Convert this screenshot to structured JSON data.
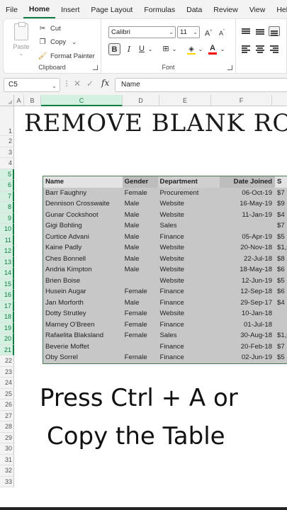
{
  "menu": [
    "File",
    "Home",
    "Insert",
    "Page Layout",
    "Formulas",
    "Data",
    "Review",
    "View",
    "Help"
  ],
  "menu_active": "Home",
  "clipboard": {
    "paste_label": "Paste",
    "cut_label": "Cut",
    "copy_label": "Copy",
    "format_painter_label": "Format Painter",
    "group_label": "Clipboard"
  },
  "font_group": {
    "font_name": "Calibri",
    "font_size": "11",
    "group_label": "Font",
    "bold": "B",
    "italic": "I",
    "underline": "U",
    "grow": "A",
    "shrink": "A"
  },
  "formula_bar": {
    "name_box": "C5",
    "formula": "Name"
  },
  "columns": [
    "A",
    "B",
    "C",
    "D",
    "E",
    "F"
  ],
  "rows": [
    "1",
    "2",
    "3",
    "4",
    "5",
    "6",
    "7",
    "8",
    "9",
    "10",
    "11",
    "12",
    "13",
    "14",
    "15",
    "16",
    "17",
    "18",
    "19",
    "20",
    "21",
    "22",
    "23",
    "24",
    "25",
    "26",
    "27",
    "28",
    "29",
    "30",
    "31",
    "32",
    "33"
  ],
  "title": "REMOVE BLANK ROWS",
  "table": {
    "headers": [
      "Name",
      "Gender",
      "Department",
      "Date Joined",
      "S"
    ],
    "rows": [
      [
        "Barr Faughny",
        "Female",
        "Procurement",
        "06-Oct-19",
        "$7"
      ],
      [
        "Dennison Crosswaite",
        "Male",
        "Website",
        "16-May-19",
        "$9"
      ],
      [
        "Gunar Cockshoot",
        "Male",
        "Website",
        "11-Jan-19",
        "$4"
      ],
      [
        "Gigi Bohling",
        "Male",
        "Sales",
        "",
        "$7"
      ],
      [
        "Curtice Advani",
        "Male",
        "Finance",
        "05-Apr-19",
        "$5"
      ],
      [
        "Kaine Padly",
        "Male",
        "Website",
        "20-Nov-18",
        "$1,0"
      ],
      [
        "Ches Bonnell",
        "Male",
        "Website",
        "22-Jul-18",
        "$8"
      ],
      [
        "Andria Kimpton",
        "Male",
        "Website",
        "18-May-18",
        "$6"
      ],
      [
        "Brien Boise",
        "",
        "Website",
        "12-Jun-19",
        "$5"
      ],
      [
        "Husein Augar",
        "Female",
        "Finance",
        "12-Sep-18",
        "$6"
      ],
      [
        "Jan Morforth",
        "Male",
        "Finance",
        "29-Sep-17",
        "$4"
      ],
      [
        "Dotty Strutley",
        "Female",
        "Website",
        "10-Jan-18",
        ""
      ],
      [
        "Marney O'Breen",
        "Female",
        "Finance",
        "01-Jul-18",
        ""
      ],
      [
        "Rafaelita Blaksland",
        "Female",
        "Sales",
        "30-Aug-18",
        "$1,0"
      ],
      [
        "Beverie Moffet",
        "",
        "Finance",
        "20-Feb-18",
        "$7"
      ],
      [
        "Oby Sorrel",
        "Female",
        "Finance",
        "02-Jun-19",
        "$5"
      ]
    ]
  },
  "overlay": {
    "line1": "Press Ctrl + A or",
    "line2": "Copy the Table"
  },
  "colors": {
    "accent": "#107c41",
    "table_fill": "#c7c7c7",
    "table_border": "#4c7a55"
  }
}
